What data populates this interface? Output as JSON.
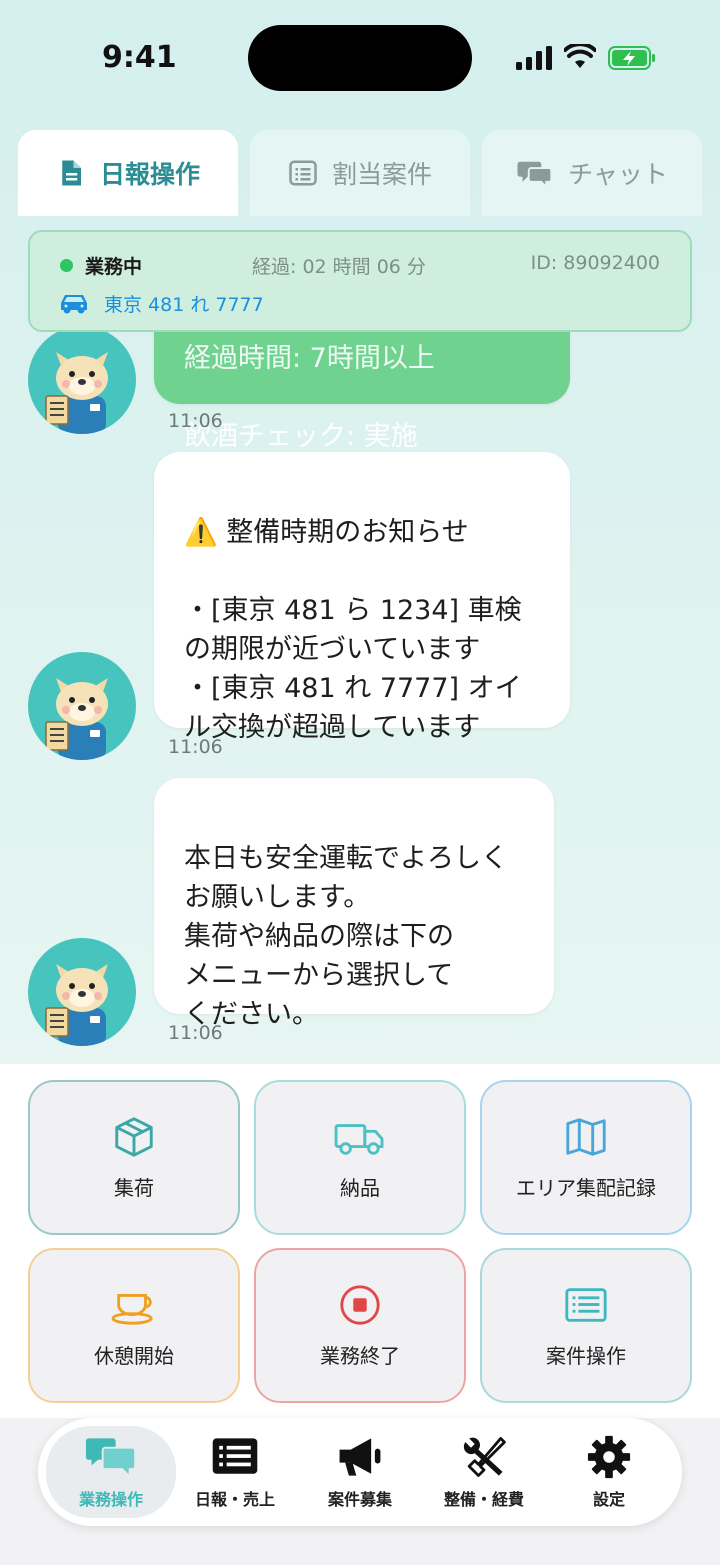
{
  "status_bar": {
    "time": "9:41"
  },
  "tabs": [
    {
      "label": "日報操作",
      "icon": "document-icon",
      "active": true
    },
    {
      "label": "割当案件",
      "icon": "list-icon",
      "active": false
    },
    {
      "label": "チャット",
      "icon": "chat-icon",
      "active": false
    }
  ],
  "status_card": {
    "state": "業務中",
    "elapsed": "経過: 02 時間 06 分",
    "id": "ID: 89092400",
    "plate": "東京 481 れ 7777"
  },
  "messages": [
    {
      "text": "飲酒チェック: 実施",
      "time": "11:06",
      "style": "green",
      "partial_top": "経過時間: 7時間以上"
    },
    {
      "text": "⚠️ 整備時期のお知らせ\n\n・[東京 481 ら 1234] 車検の期限が近づいています\n・[東京 481 れ 7777] オイル交換が超過しています",
      "time": "11:06",
      "style": "white"
    },
    {
      "text": "本日も安全運転でよろしく\nお願いします。\n集荷や納品の際は下の\nメニューから選択して\nください。",
      "time": "11:06",
      "style": "white"
    }
  ],
  "actions": [
    {
      "label": "集荷",
      "icon": "box-icon",
      "color": "#3aa8a8"
    },
    {
      "label": "納品",
      "icon": "truck-icon",
      "color": "#4cc1c4"
    },
    {
      "label": "エリア集配記録",
      "icon": "map-icon",
      "color": "#4aa6d8"
    },
    {
      "label": "休憩開始",
      "icon": "coffee-icon",
      "color": "#f0a020"
    },
    {
      "label": "業務終了",
      "icon": "stop-icon",
      "color": "#e04848"
    },
    {
      "label": "案件操作",
      "icon": "list-card-icon",
      "color": "#3cb8c0"
    }
  ],
  "nav": [
    {
      "label": "業務操作",
      "icon": "chat-bubbles-icon",
      "active": true
    },
    {
      "label": "日報・売上",
      "icon": "list-icon",
      "active": false
    },
    {
      "label": "案件募集",
      "icon": "megaphone-icon",
      "active": false
    },
    {
      "label": "整備・経費",
      "icon": "tools-icon",
      "active": false
    },
    {
      "label": "設定",
      "icon": "gear-icon",
      "active": false
    }
  ]
}
